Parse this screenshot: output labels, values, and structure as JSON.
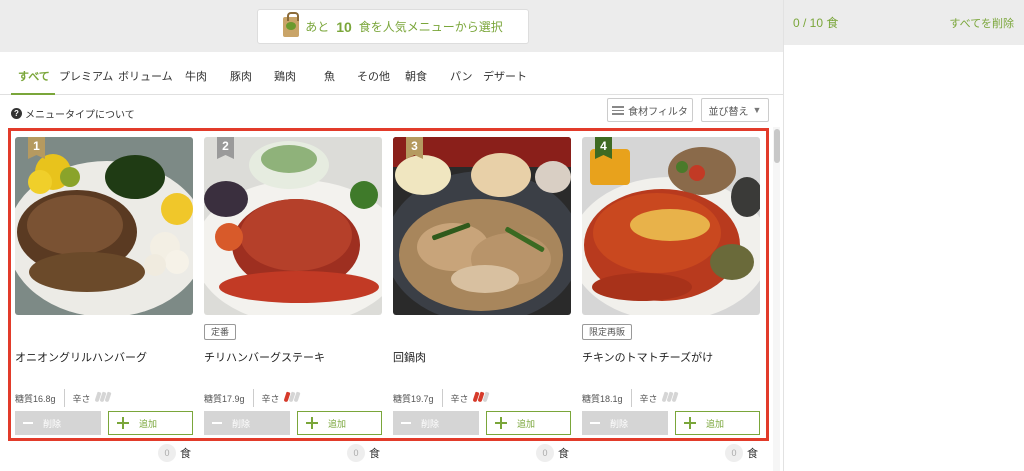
{
  "banner": {
    "prefix": "あと",
    "count": "10",
    "suffix": "食を人気メニューから選択"
  },
  "side": {
    "count": "0 / 10 食",
    "clear": "すべてを削除"
  },
  "tabs": [
    "すべて",
    "プレミアム",
    "ボリューム",
    "牛肉",
    "豚肉",
    "鶏肉",
    "魚",
    "その他",
    "朝食",
    "パン",
    "デザート"
  ],
  "help": {
    "icon": "?",
    "label": "メニュータイプについて"
  },
  "filters": {
    "ingredient": "食材フィルタ",
    "sort": "並び替え",
    "sort_caret": "▼"
  },
  "labels": {
    "spice": "辛さ",
    "delete": "削除",
    "add": "追加",
    "unit": "食"
  },
  "colors": {
    "accent": "#7aa63a",
    "highlight": "#e23b2a",
    "rank_gold": "#b59a60",
    "rank_gray": "#9a9a9a",
    "rank_green": "#3e6a22"
  },
  "cards": [
    {
      "rank": "1",
      "tag": "",
      "name": "オニオングリルハンバーグ",
      "carb": "糖質16.8g",
      "spice_level": 0,
      "count": "0"
    },
    {
      "rank": "2",
      "tag": "定番",
      "name": "チリハンバーグステーキ",
      "carb": "糖質17.9g",
      "spice_level": 1,
      "count": "0"
    },
    {
      "rank": "3",
      "tag": "",
      "name": "回鍋肉",
      "carb": "糖質19.7g",
      "spice_level": 2,
      "count": "0"
    },
    {
      "rank": "4",
      "tag": "限定再販",
      "name": "チキンのトマトチーズがけ",
      "carb": "糖質18.1g",
      "spice_level": 0,
      "count": "0"
    }
  ]
}
